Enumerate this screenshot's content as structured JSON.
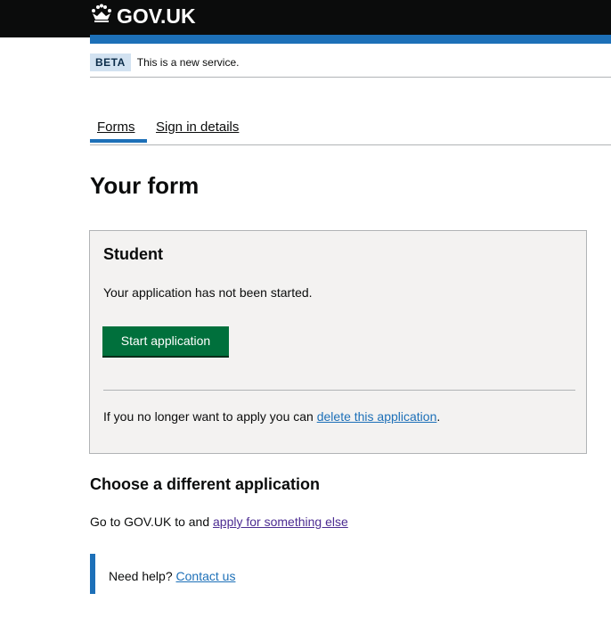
{
  "header": {
    "logo_text": "GOV.UK",
    "crown_icon": "crown-icon"
  },
  "phase_banner": {
    "tag": "BETA",
    "text": "This is a new service."
  },
  "subnav": {
    "items": [
      {
        "label": "Forms",
        "active": true
      },
      {
        "label": "Sign in details",
        "active": false
      }
    ]
  },
  "page": {
    "title": "Your form"
  },
  "application_card": {
    "heading": "Student",
    "status": "Your application has not been started.",
    "start_button": "Start application",
    "delete_prefix": "If you no longer want to apply you can ",
    "delete_link": "delete this application",
    "delete_suffix": "."
  },
  "different_application": {
    "heading": "Choose a different application",
    "prefix": "Go to GOV.UK to and ",
    "link": "apply for something else"
  },
  "help": {
    "prefix": "Need help? ",
    "link": "Contact us"
  },
  "colors": {
    "header_bg": "#0b0c0c",
    "brand_blue": "#1d70b8",
    "button_green": "#00703c",
    "card_bg": "#f3f2f1",
    "visited_link": "#4c2c92"
  }
}
